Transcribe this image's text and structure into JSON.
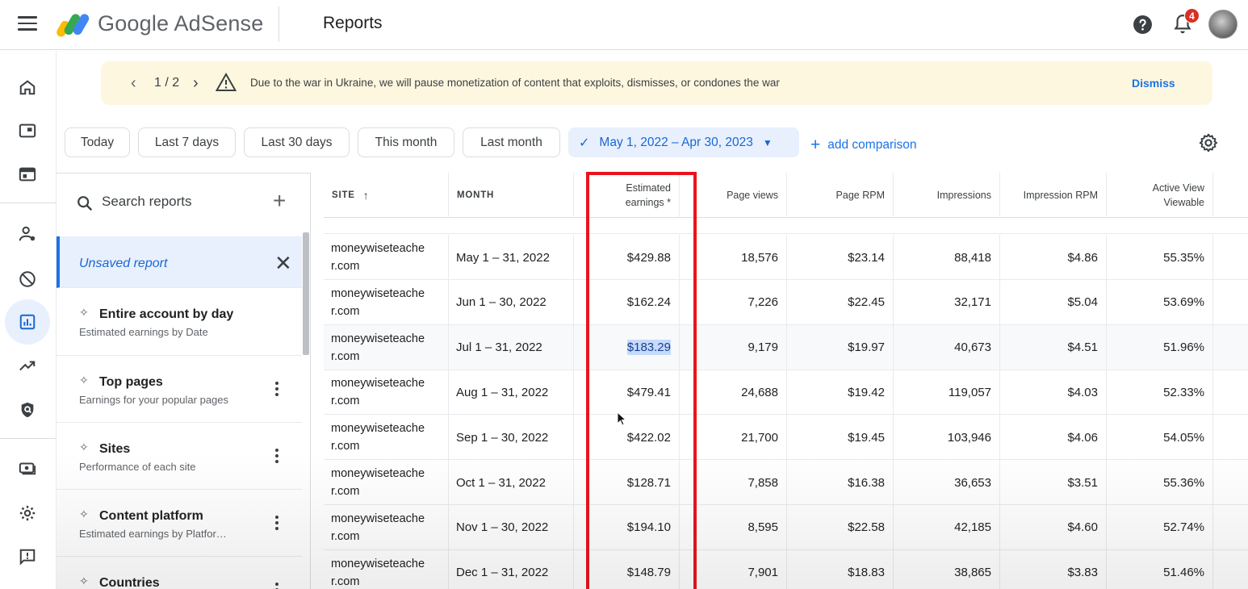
{
  "header": {
    "brand": "Google AdSense",
    "page_title": "Reports",
    "notification_count": "4"
  },
  "rail": {
    "icons": [
      "home-icon",
      "ads-icon",
      "sites-icon",
      "account-icon",
      "blocking-icon",
      "reports-icon",
      "optimization-icon",
      "privacy-icon",
      "payments-icon",
      "settings-icon",
      "feedback-icon"
    ],
    "active": "reports-icon"
  },
  "banner": {
    "page": "1 / 2",
    "text": "Due to the war in Ukraine, we will pause monetization of content that exploits, dismisses, or condones the war",
    "dismiss": "Dismiss"
  },
  "date_filters": {
    "today": "Today",
    "last7": "Last 7 days",
    "last30": "Last 30 days",
    "this_month": "This month",
    "last_month": "Last month",
    "selected_range": "May 1, 2022 – Apr 30, 2023",
    "add_comparison": "add comparison"
  },
  "reports_panel": {
    "search_placeholder": "Search reports",
    "unsaved": "Unsaved report",
    "items": [
      {
        "title": "Entire account by day",
        "subtitle": "Estimated earnings by Date"
      },
      {
        "title": "Top pages",
        "subtitle": "Earnings for your popular pages"
      },
      {
        "title": "Sites",
        "subtitle": "Performance of each site"
      },
      {
        "title": "Content platform",
        "subtitle": "Estimated earnings by Platfor…"
      },
      {
        "title": "Countries",
        "subtitle": ""
      }
    ]
  },
  "table": {
    "headers": {
      "site": "SITE",
      "month": "MONTH",
      "earnings_1": "Estimated",
      "earnings_2": "earnings *",
      "page_views": "Page views",
      "page_rpm": "Page RPM",
      "impressions": "Impressions",
      "impression_rpm": "Impression RPM",
      "active_view_1": "Active View",
      "active_view_2": "Viewable"
    },
    "rows": [
      {
        "site_1": "moneywiseteache",
        "site_2": "r.com",
        "month": "May 1 – 31, 2022",
        "earnings": "$429.88",
        "page_views": "18,576",
        "page_rpm": "$23.14",
        "impressions": "88,418",
        "impression_rpm": "$4.86",
        "viewable": "55.35%"
      },
      {
        "site_1": "moneywiseteache",
        "site_2": "r.com",
        "month": "Jun 1 – 30, 2022",
        "earnings": "$162.24",
        "page_views": "7,226",
        "page_rpm": "$22.45",
        "impressions": "32,171",
        "impression_rpm": "$5.04",
        "viewable": "53.69%"
      },
      {
        "site_1": "moneywiseteache",
        "site_2": "r.com",
        "month": "Jul 1 – 31, 2022",
        "earnings": "$183.29",
        "page_views": "9,179",
        "page_rpm": "$19.97",
        "impressions": "40,673",
        "impression_rpm": "$4.51",
        "viewable": "51.96%"
      },
      {
        "site_1": "moneywiseteache",
        "site_2": "r.com",
        "month": "Aug 1 – 31, 2022",
        "earnings": "$479.41",
        "page_views": "24,688",
        "page_rpm": "$19.42",
        "impressions": "119,057",
        "impression_rpm": "$4.03",
        "viewable": "52.33%"
      },
      {
        "site_1": "moneywiseteache",
        "site_2": "r.com",
        "month": "Sep 1 – 30, 2022",
        "earnings": "$422.02",
        "page_views": "21,700",
        "page_rpm": "$19.45",
        "impressions": "103,946",
        "impression_rpm": "$4.06",
        "viewable": "54.05%"
      },
      {
        "site_1": "moneywiseteache",
        "site_2": "r.com",
        "month": "Oct 1 – 31, 2022",
        "earnings": "$128.71",
        "page_views": "7,858",
        "page_rpm": "$16.38",
        "impressions": "36,653",
        "impression_rpm": "$3.51",
        "viewable": "55.36%"
      },
      {
        "site_1": "moneywiseteache",
        "site_2": "r.com",
        "month": "Nov 1 – 30, 2022",
        "earnings": "$194.10",
        "page_views": "8,595",
        "page_rpm": "$22.58",
        "impressions": "42,185",
        "impression_rpm": "$4.60",
        "viewable": "52.74%"
      },
      {
        "site_1": "moneywiseteache",
        "site_2": "r.com",
        "month": "Dec 1 – 31, 2022",
        "earnings": "$148.79",
        "page_views": "7,901",
        "page_rpm": "$18.83",
        "impressions": "38,865",
        "impression_rpm": "$3.83",
        "viewable": "51.46%"
      }
    ],
    "selected_cell": "$183.29"
  },
  "colors": {
    "accent": "#1a73e8",
    "banner_bg": "#fef7e0",
    "highlight_box": "#e8141c",
    "badge": "#d93025"
  }
}
